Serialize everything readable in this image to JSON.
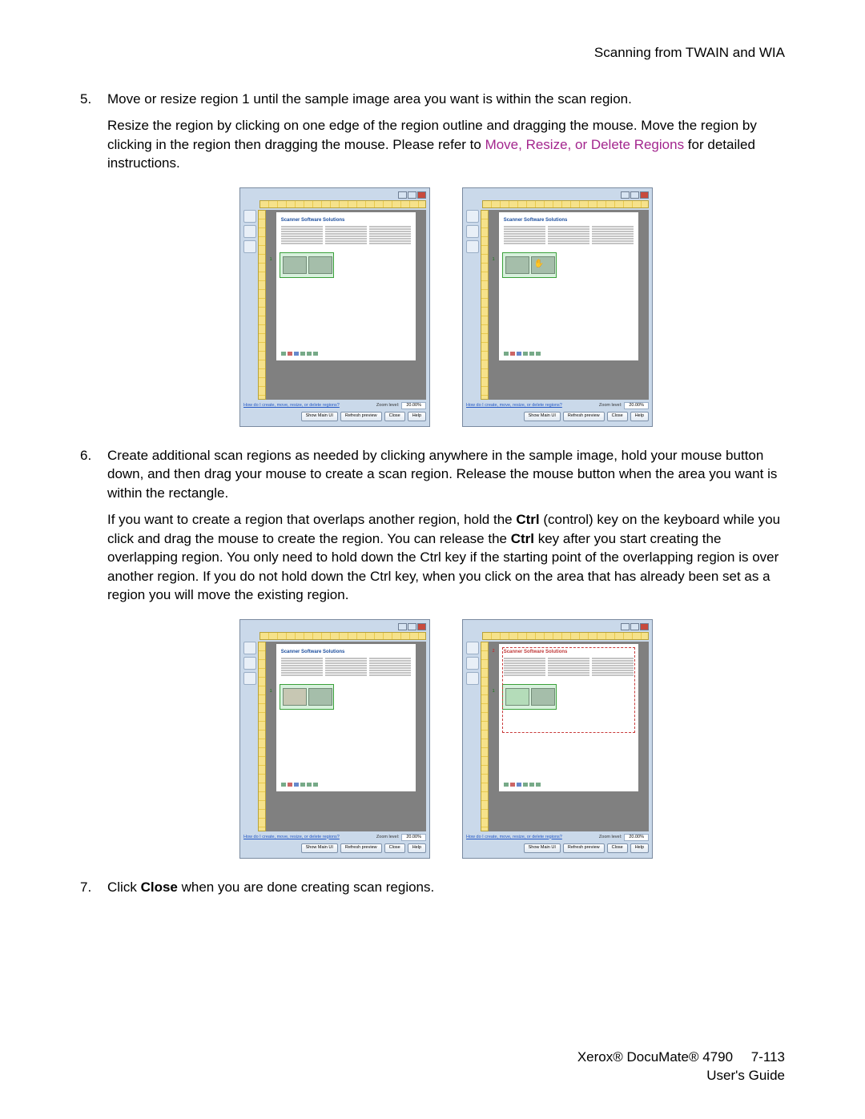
{
  "header": {
    "title": "Scanning from TWAIN and WIA"
  },
  "steps": [
    {
      "num": "5.",
      "paragraphs": [
        {
          "t": "Move or resize region 1 until the sample image area you want is within the scan region."
        },
        {
          "pre": "Resize the region by clicking on one edge of the region outline and dragging the mouse. Move the region by clicking in the region then dragging the mouse. Please refer to ",
          "link": "Move, Resize, or Delete Regions",
          "post": " for detailed instructions."
        }
      ]
    },
    {
      "num": "6.",
      "paragraphs": [
        {
          "t": "Create additional scan regions as needed by clicking anywhere in the sample image, hold your mouse button down, and then drag your mouse to create a scan region. Release the mouse button when the area you want is within the rectangle."
        },
        {
          "t_html": "If you want to create a region that overlaps another region, hold the <b>Ctrl</b> (control) key on the keyboard while you click and drag the mouse to create the region. You can release the <b>Ctrl</b> key after you start creating the overlapping region. You only need to hold down the Ctrl key if the starting point of the overlapping region is over another region. If you do not hold down the Ctrl key, when you click on the area that has already been set as a region you will move the existing region."
        }
      ]
    },
    {
      "num": "7.",
      "paragraphs": [
        {
          "t_html": "Click <b>Close</b> when you are done creating scan regions."
        }
      ]
    }
  ],
  "dialog": {
    "paper_title": "Scanner Software Solutions",
    "help_link": "How do I create, move, resize, or delete regions?",
    "zoom_label": "Zoom level:",
    "zoom_value": "20.00%",
    "buttons": {
      "show_main": "Show Main UI",
      "refresh": "Refresh preview",
      "close": "Close",
      "help": "Help"
    }
  },
  "footer": {
    "product": "Xerox® DocuMate® 4790",
    "page": "7-113",
    "guide": "User's Guide"
  }
}
